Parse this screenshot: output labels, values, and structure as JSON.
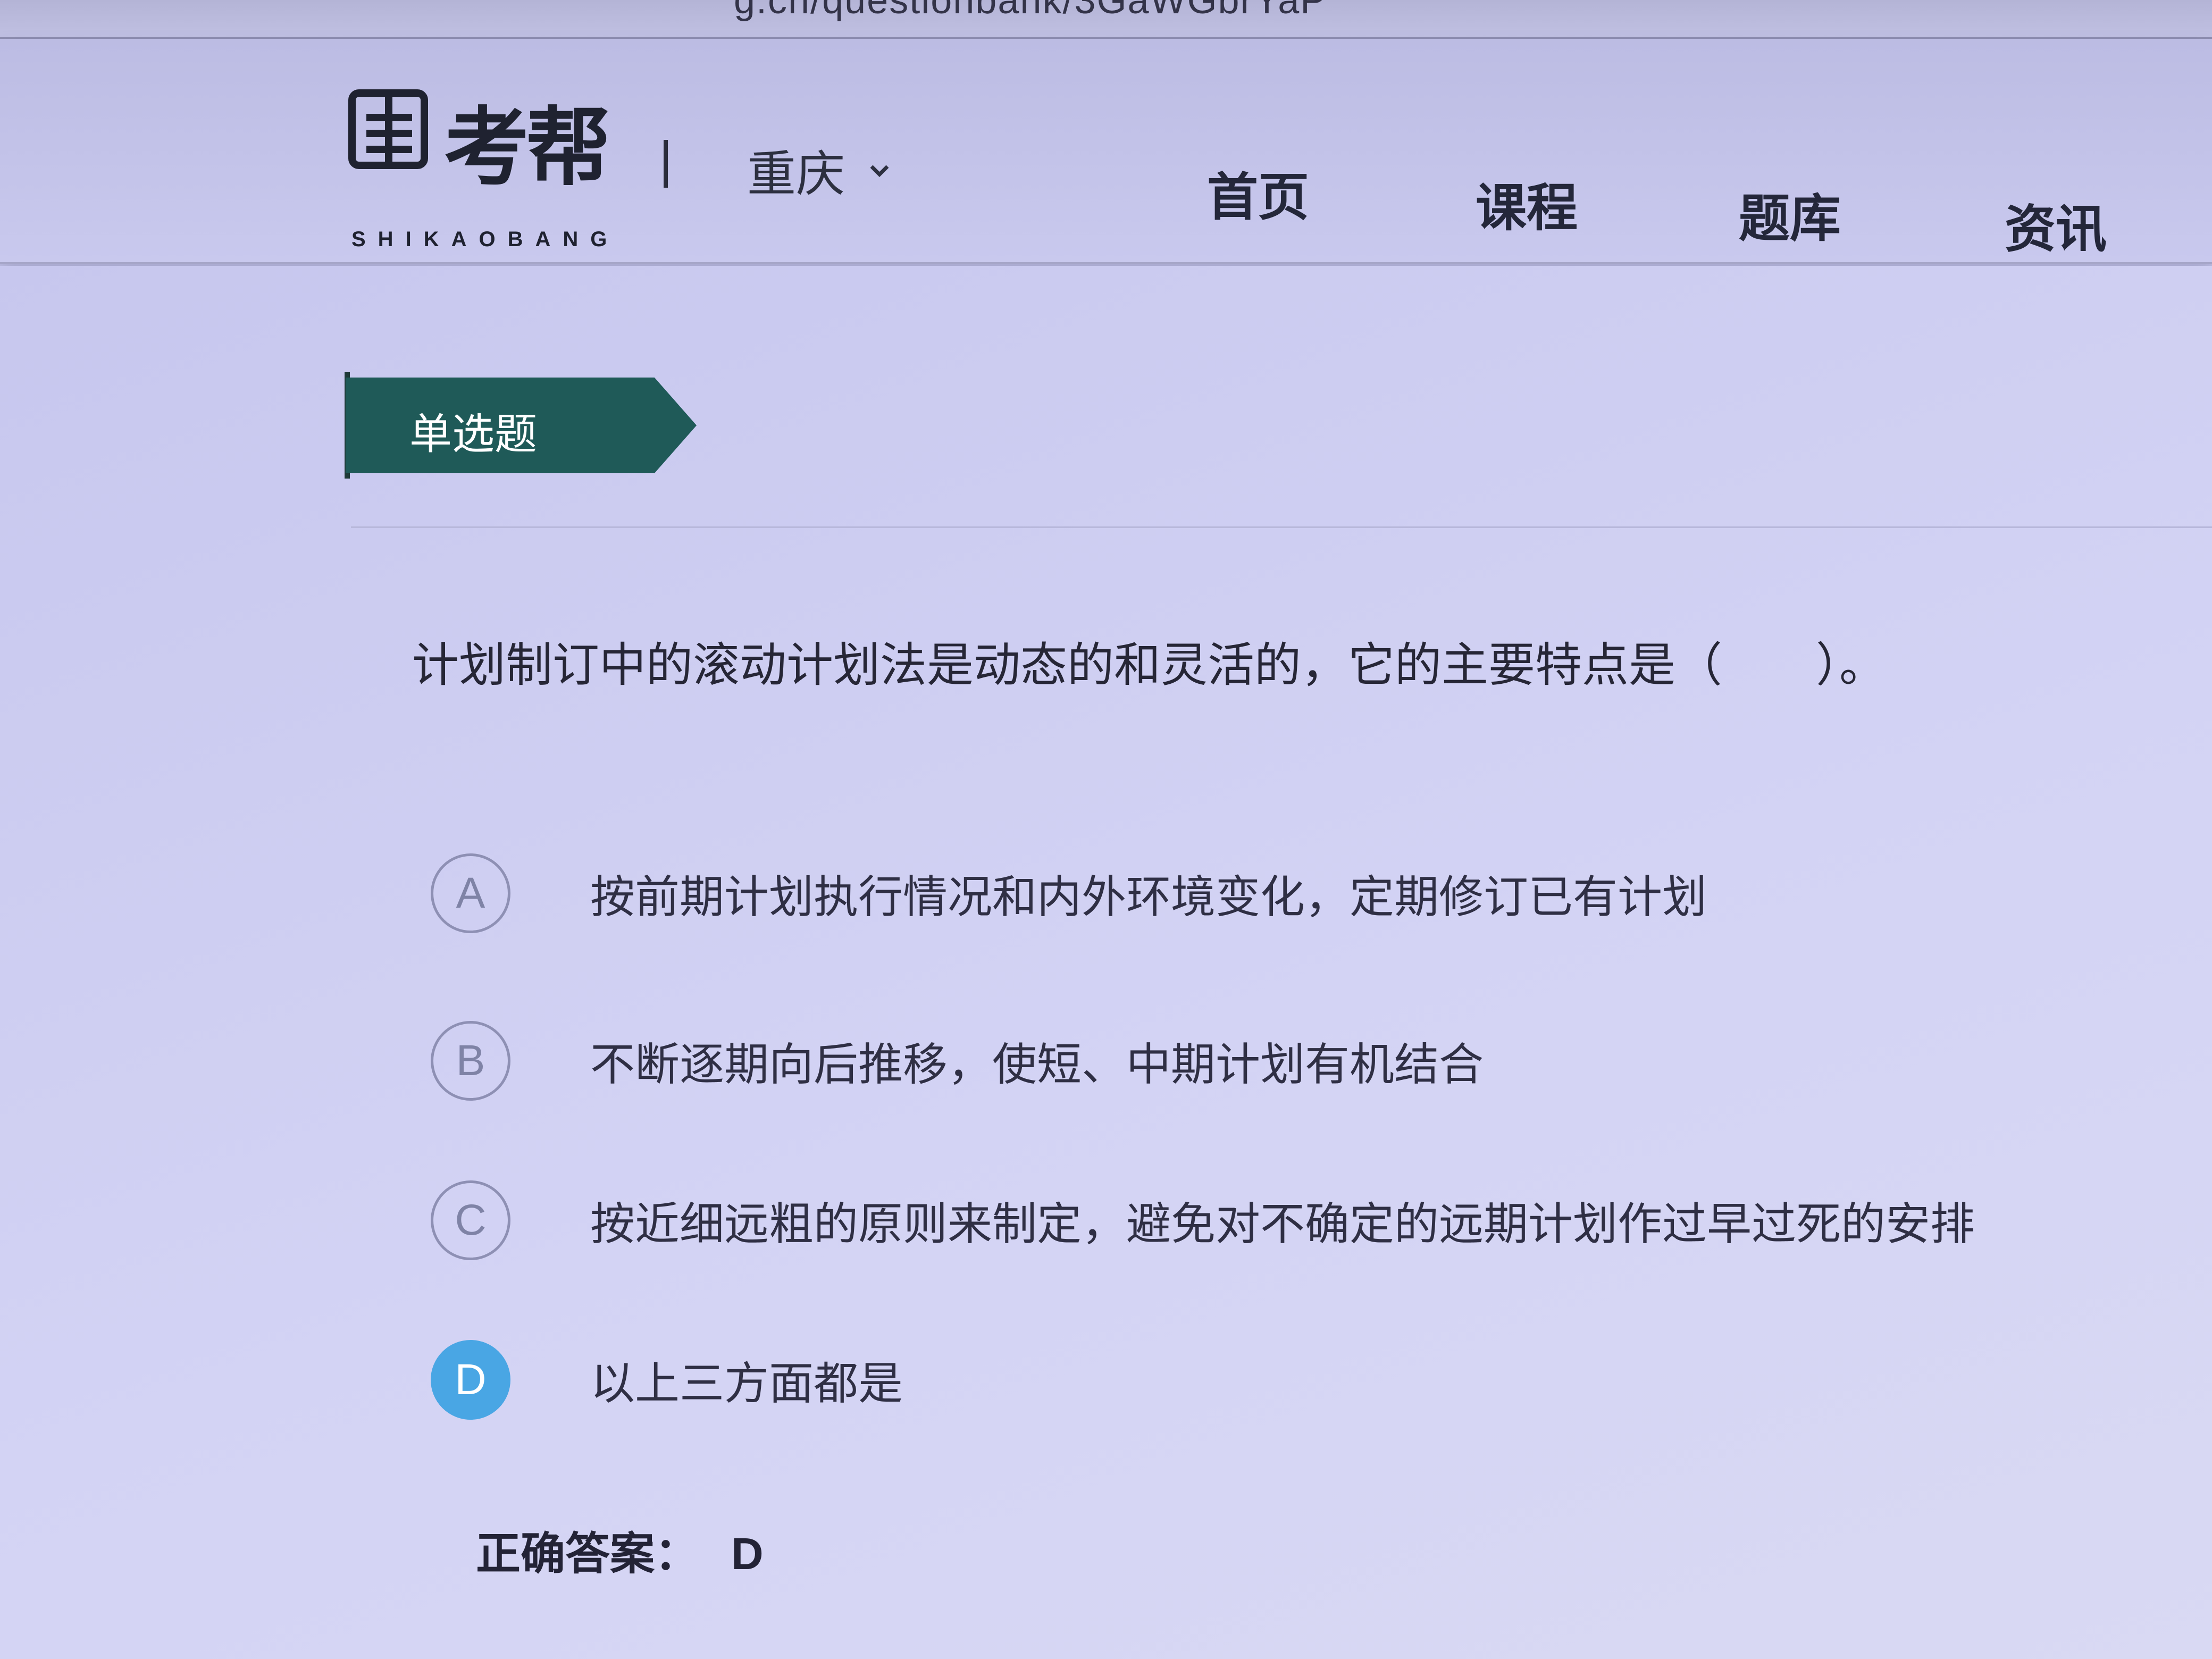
{
  "browser": {
    "url_partial": "g.cn/questionbank/3GaWGbrYaP"
  },
  "header": {
    "logo_text": "考帮",
    "logo_sub": "SHIKAOBANG",
    "city": "重庆",
    "nav": [
      {
        "label": "首页"
      },
      {
        "label": "课程"
      },
      {
        "label": "题库"
      },
      {
        "label": "资讯"
      }
    ]
  },
  "question": {
    "type_label": "单选题",
    "stem": "计划制订中的滚动计划法是动态的和灵活的，它的主要特点是（　　）。",
    "options": [
      {
        "letter": "A",
        "text": "按前期计划执行情况和内外环境变化，定期修订已有计划",
        "selected": false
      },
      {
        "letter": "B",
        "text": "不断逐期向后推移，使短、中期计划有机结合",
        "selected": false
      },
      {
        "letter": "C",
        "text": "按近细远粗的原则来制定，避免对不确定的远期计划作过早过死的安排",
        "selected": false
      },
      {
        "letter": "D",
        "text": "以上三方面都是",
        "selected": true
      }
    ],
    "answer_label": "正确答案：",
    "answer_value": "D"
  },
  "colors": {
    "tag_bg": "#1f5a58",
    "selected_option": "#49a6e4",
    "background": "#c9c9ee"
  }
}
